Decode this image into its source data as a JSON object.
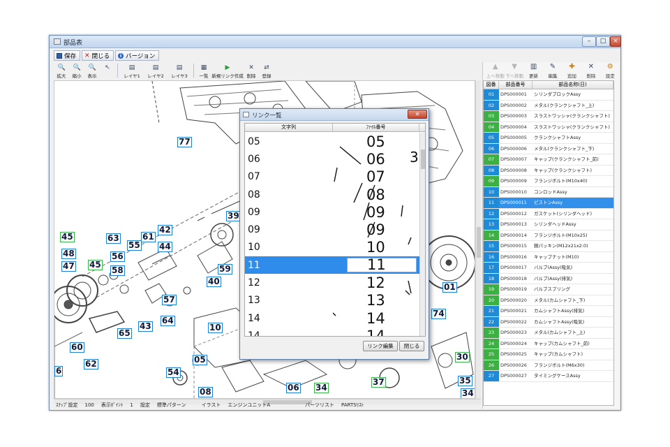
{
  "window": {
    "title": "部品表"
  },
  "menu": [
    {
      "label": "保存",
      "icon": "save-icon"
    },
    {
      "label": "閉じる",
      "icon": "close-icon"
    },
    {
      "label": "バージョン",
      "icon": "info-icon"
    }
  ],
  "toolbar": [
    {
      "label": "拡大",
      "icon": "zoom-in-icon"
    },
    {
      "label": "縮小",
      "icon": "zoom-out-icon"
    },
    {
      "label": "表示",
      "icon": "view-icon"
    },
    {
      "label": "",
      "icon": "pointer-icon"
    },
    {
      "label": "レイヤ1",
      "icon": "layer-icon"
    },
    {
      "label": "レイヤ2",
      "icon": "layer-icon"
    },
    {
      "label": "レイヤ3",
      "icon": "layer-icon"
    },
    {
      "label": "一覧",
      "icon": "list-icon"
    },
    {
      "label": "新規リンク作成",
      "icon": "new-link-icon"
    },
    {
      "label": "削除",
      "icon": "delete-icon"
    },
    {
      "label": "登録",
      "icon": "register-icon"
    }
  ],
  "callouts": [
    {
      "text": "77",
      "color": "blue"
    },
    {
      "text": "39",
      "color": "blue"
    },
    {
      "text": "45",
      "color": "green"
    },
    {
      "text": "48",
      "color": "blue"
    },
    {
      "text": "47",
      "color": "blue"
    },
    {
      "text": "45",
      "color": "green"
    },
    {
      "text": "63",
      "color": "blue"
    },
    {
      "text": "56",
      "color": "blue"
    },
    {
      "text": "58",
      "color": "blue"
    },
    {
      "text": "55",
      "color": "blue"
    },
    {
      "text": "61",
      "color": "blue"
    },
    {
      "text": "42",
      "color": "blue"
    },
    {
      "text": "44",
      "color": "blue"
    },
    {
      "text": "59",
      "color": "blue"
    },
    {
      "text": "40",
      "color": "blue"
    },
    {
      "text": "57",
      "color": "blue"
    },
    {
      "text": "43",
      "color": "blue"
    },
    {
      "text": "64",
      "color": "blue"
    },
    {
      "text": "65",
      "color": "blue"
    },
    {
      "text": "60",
      "color": "blue"
    },
    {
      "text": "62",
      "color": "blue"
    },
    {
      "text": "10",
      "color": "blue"
    },
    {
      "text": "05",
      "color": "blue"
    },
    {
      "text": "54",
      "color": "blue"
    },
    {
      "text": "08",
      "color": "blue"
    },
    {
      "text": "06",
      "color": "blue"
    },
    {
      "text": "34",
      "color": "green"
    },
    {
      "text": "37",
      "color": "green"
    },
    {
      "text": "01",
      "color": "blue"
    },
    {
      "text": "74",
      "color": "blue"
    },
    {
      "text": "30",
      "color": "green"
    },
    {
      "text": "35",
      "color": "blue"
    },
    {
      "text": "34",
      "color": "blue"
    },
    {
      "text": "6",
      "color": "blue"
    }
  ],
  "status": [
    {
      "text": "ｽﾅｯﾌﾟ設定"
    },
    {
      "text": "100"
    },
    {
      "text": "表示ﾎﾟｲﾝﾄ"
    },
    {
      "text": "1"
    },
    {
      "text": "設定"
    },
    {
      "text": "標準パターン"
    },
    {
      "text": "イラスト"
    },
    {
      "text": "エンジンユニットA"
    },
    {
      "text": "パーツリスト"
    },
    {
      "text": "PARTSﾘｽﾄ"
    }
  ],
  "right_toolbar": [
    {
      "label": "上へ移動",
      "icon": "move-up-icon",
      "enabled": false
    },
    {
      "label": "下へ移動",
      "icon": "move-down-icon",
      "enabled": false
    },
    {
      "label": "更新",
      "icon": "refresh-icon",
      "enabled": true
    },
    {
      "label": "編集",
      "icon": "edit-icon",
      "enabled": true
    },
    {
      "label": "追加",
      "icon": "add-icon",
      "enabled": true
    },
    {
      "label": "削除",
      "icon": "delete-icon",
      "enabled": true
    },
    {
      "label": "設定",
      "icon": "settings-icon",
      "enabled": true
    }
  ],
  "parts_list": {
    "headers": [
      "図番",
      "部品番号",
      "部品名称(日)"
    ],
    "rows": [
      {
        "num": "01",
        "code": "DPS000001",
        "name": "シリンダブロックAssy",
        "color": "#1f8ad6"
      },
      {
        "num": "02",
        "code": "DPS000002",
        "name": "メタル(クランクシャフト_上)",
        "color": "#1f8ad6"
      },
      {
        "num": "03",
        "code": "DPS000003",
        "name": "スラストワッシャ(クランクシャフト)",
        "color": "#3cb043"
      },
      {
        "num": "04",
        "code": "DPS000004",
        "name": "スラストワッシャ(クランクシャフト)",
        "color": "#3cb043"
      },
      {
        "num": "05",
        "code": "DPS000005",
        "name": "クランクシャフトAssy",
        "color": "#1f8ad6"
      },
      {
        "num": "06",
        "code": "DPS000006",
        "name": "メタル(クランクシャフト_下)",
        "color": "#1f8ad6"
      },
      {
        "num": "07",
        "code": "DPS000007",
        "name": "キャップ(クランクシャフト_前)",
        "color": "#3cb043"
      },
      {
        "num": "08",
        "code": "DPS000008",
        "name": "キャップ(クランクシャフト)",
        "color": "#1f8ad6"
      },
      {
        "num": "09",
        "code": "DPS000009",
        "name": "フランジボルト(M10x40)",
        "color": "#3cb043"
      },
      {
        "num": "10",
        "code": "DPS000010",
        "name": "コンロッドAssy",
        "color": "#1f8ad6"
      },
      {
        "num": "11",
        "code": "DPS000011",
        "name": "ピストンAssy",
        "color": "#1f8ad6",
        "selected": true
      },
      {
        "num": "12",
        "code": "DPS000012",
        "name": "ガスケット(シリンダヘッド)",
        "color": "#1f8ad6"
      },
      {
        "num": "13",
        "code": "DPS000013",
        "name": "シリンダヘッドAssy",
        "color": "#1f8ad6"
      },
      {
        "num": "14",
        "code": "DPS000014",
        "name": "フランジボルト(M10x25)",
        "color": "#3cb043"
      },
      {
        "num": "15",
        "code": "DPS000015",
        "name": "銅パッキン(M12x21x2.0)",
        "color": "#1f8ad6"
      },
      {
        "num": "16",
        "code": "DPS000016",
        "name": "キャップナット(M10)",
        "color": "#1f8ad6"
      },
      {
        "num": "17",
        "code": "DPS000017",
        "name": "バルブ(Assy(吸気)",
        "color": "#1f8ad6"
      },
      {
        "num": "18",
        "code": "DPS000018",
        "name": "バルブ(Assy(排気)",
        "color": "#1f8ad6"
      },
      {
        "num": "19",
        "code": "DPS000019",
        "name": "バルブスプリング",
        "color": "#3cb043"
      },
      {
        "num": "20",
        "code": "DPS000020",
        "name": "メタル(カムシャフト_下)",
        "color": "#3cb043"
      },
      {
        "num": "21",
        "code": "DPS000021",
        "name": "カムシャフトAssy(排気)",
        "color": "#1f8ad6"
      },
      {
        "num": "22",
        "code": "DPS000022",
        "name": "カムシャフトAssy(吸気)",
        "color": "#1f8ad6"
      },
      {
        "num": "23",
        "code": "DPS000023",
        "name": "メタル(カムシャフト_上)",
        "color": "#3cb043"
      },
      {
        "num": "24",
        "code": "DPS000024",
        "name": "キャップ(カムシャフト_前)",
        "color": "#3cb043"
      },
      {
        "num": "25",
        "code": "DPS000025",
        "name": "キャップ(カムシャフト)",
        "color": "#3cb043"
      },
      {
        "num": "26",
        "code": "DPS000026",
        "name": "フランジボルト(M6x30)",
        "color": "#3cb043"
      },
      {
        "num": "27",
        "code": "DPS000027",
        "name": "タイミングケースAssy",
        "color": "#1f8ad6"
      }
    ]
  },
  "dialog": {
    "title": "リンク一覧",
    "headers": [
      "文字列",
      "ﾌｧｲﾙ番号"
    ],
    "rows": [
      {
        "key": "05",
        "value": "05"
      },
      {
        "key": "06",
        "value": "06"
      },
      {
        "key": "07",
        "value": "07"
      },
      {
        "key": "08",
        "value": "08"
      },
      {
        "key": "09",
        "value": "09"
      },
      {
        "key": "09",
        "value": "09"
      },
      {
        "key": "10",
        "value": "10"
      },
      {
        "key": "11",
        "value": "11",
        "selected": true
      },
      {
        "key": "12",
        "value": "12"
      },
      {
        "key": "13",
        "value": "13"
      },
      {
        "key": "14",
        "value": "14"
      },
      {
        "key": "14",
        "value": "14"
      }
    ],
    "overlay_digit": "3",
    "edit_button": "リンク編集",
    "close_button": "閉じる"
  }
}
